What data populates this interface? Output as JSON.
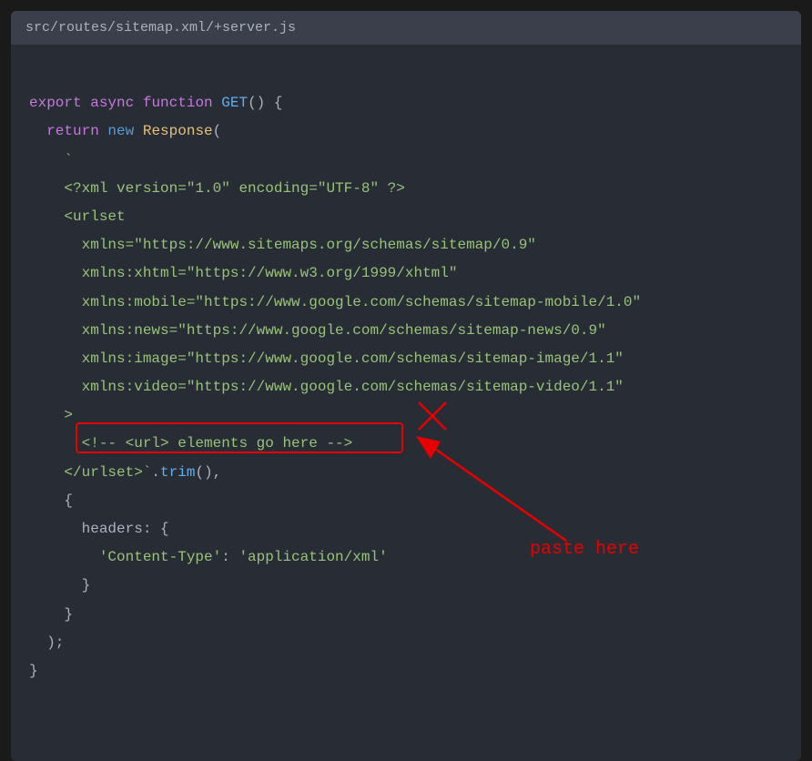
{
  "filename": "src/routes/sitemap.xml/+server.js",
  "code": {
    "l1_export": "export",
    "l1_async": "async",
    "l1_function": "function",
    "l1_fnname": "GET",
    "l1_parens": "() {",
    "l2_return": "return",
    "l2_new": "new",
    "l2_class": "Response",
    "l2_open": "(",
    "l3_backtick": "    `",
    "l4": "    <?xml version=\"1.0\" encoding=\"UTF-8\" ?>",
    "l5": "    <urlset",
    "l6": "      xmlns=\"https://www.sitemaps.org/schemas/sitemap/0.9\"",
    "l7": "      xmlns:xhtml=\"https://www.w3.org/1999/xhtml\"",
    "l8": "      xmlns:mobile=\"https://www.google.com/schemas/sitemap-mobile/1.0\"",
    "l9": "      xmlns:news=\"https://www.google.com/schemas/sitemap-news/0.9\"",
    "l10": "      xmlns:image=\"https://www.google.com/schemas/sitemap-image/1.1\"",
    "l11": "      xmlns:video=\"https://www.google.com/schemas/sitemap-video/1.1\"",
    "l12": "    >",
    "l13": "      <!-- <url> elements go here -->",
    "l14a": "    </urlset>`",
    "l14_method": "trim",
    "l14b": "(),",
    "l15": "    {",
    "l16_key": "headers",
    "l16_rest": ": {",
    "l17_key": "'Content-Type'",
    "l17_colon": ": ",
    "l17_val": "'application/xml'",
    "l18": "      }",
    "l19": "    }",
    "l20": "  );",
    "l21": "}"
  },
  "annotation": {
    "label": "paste here"
  }
}
